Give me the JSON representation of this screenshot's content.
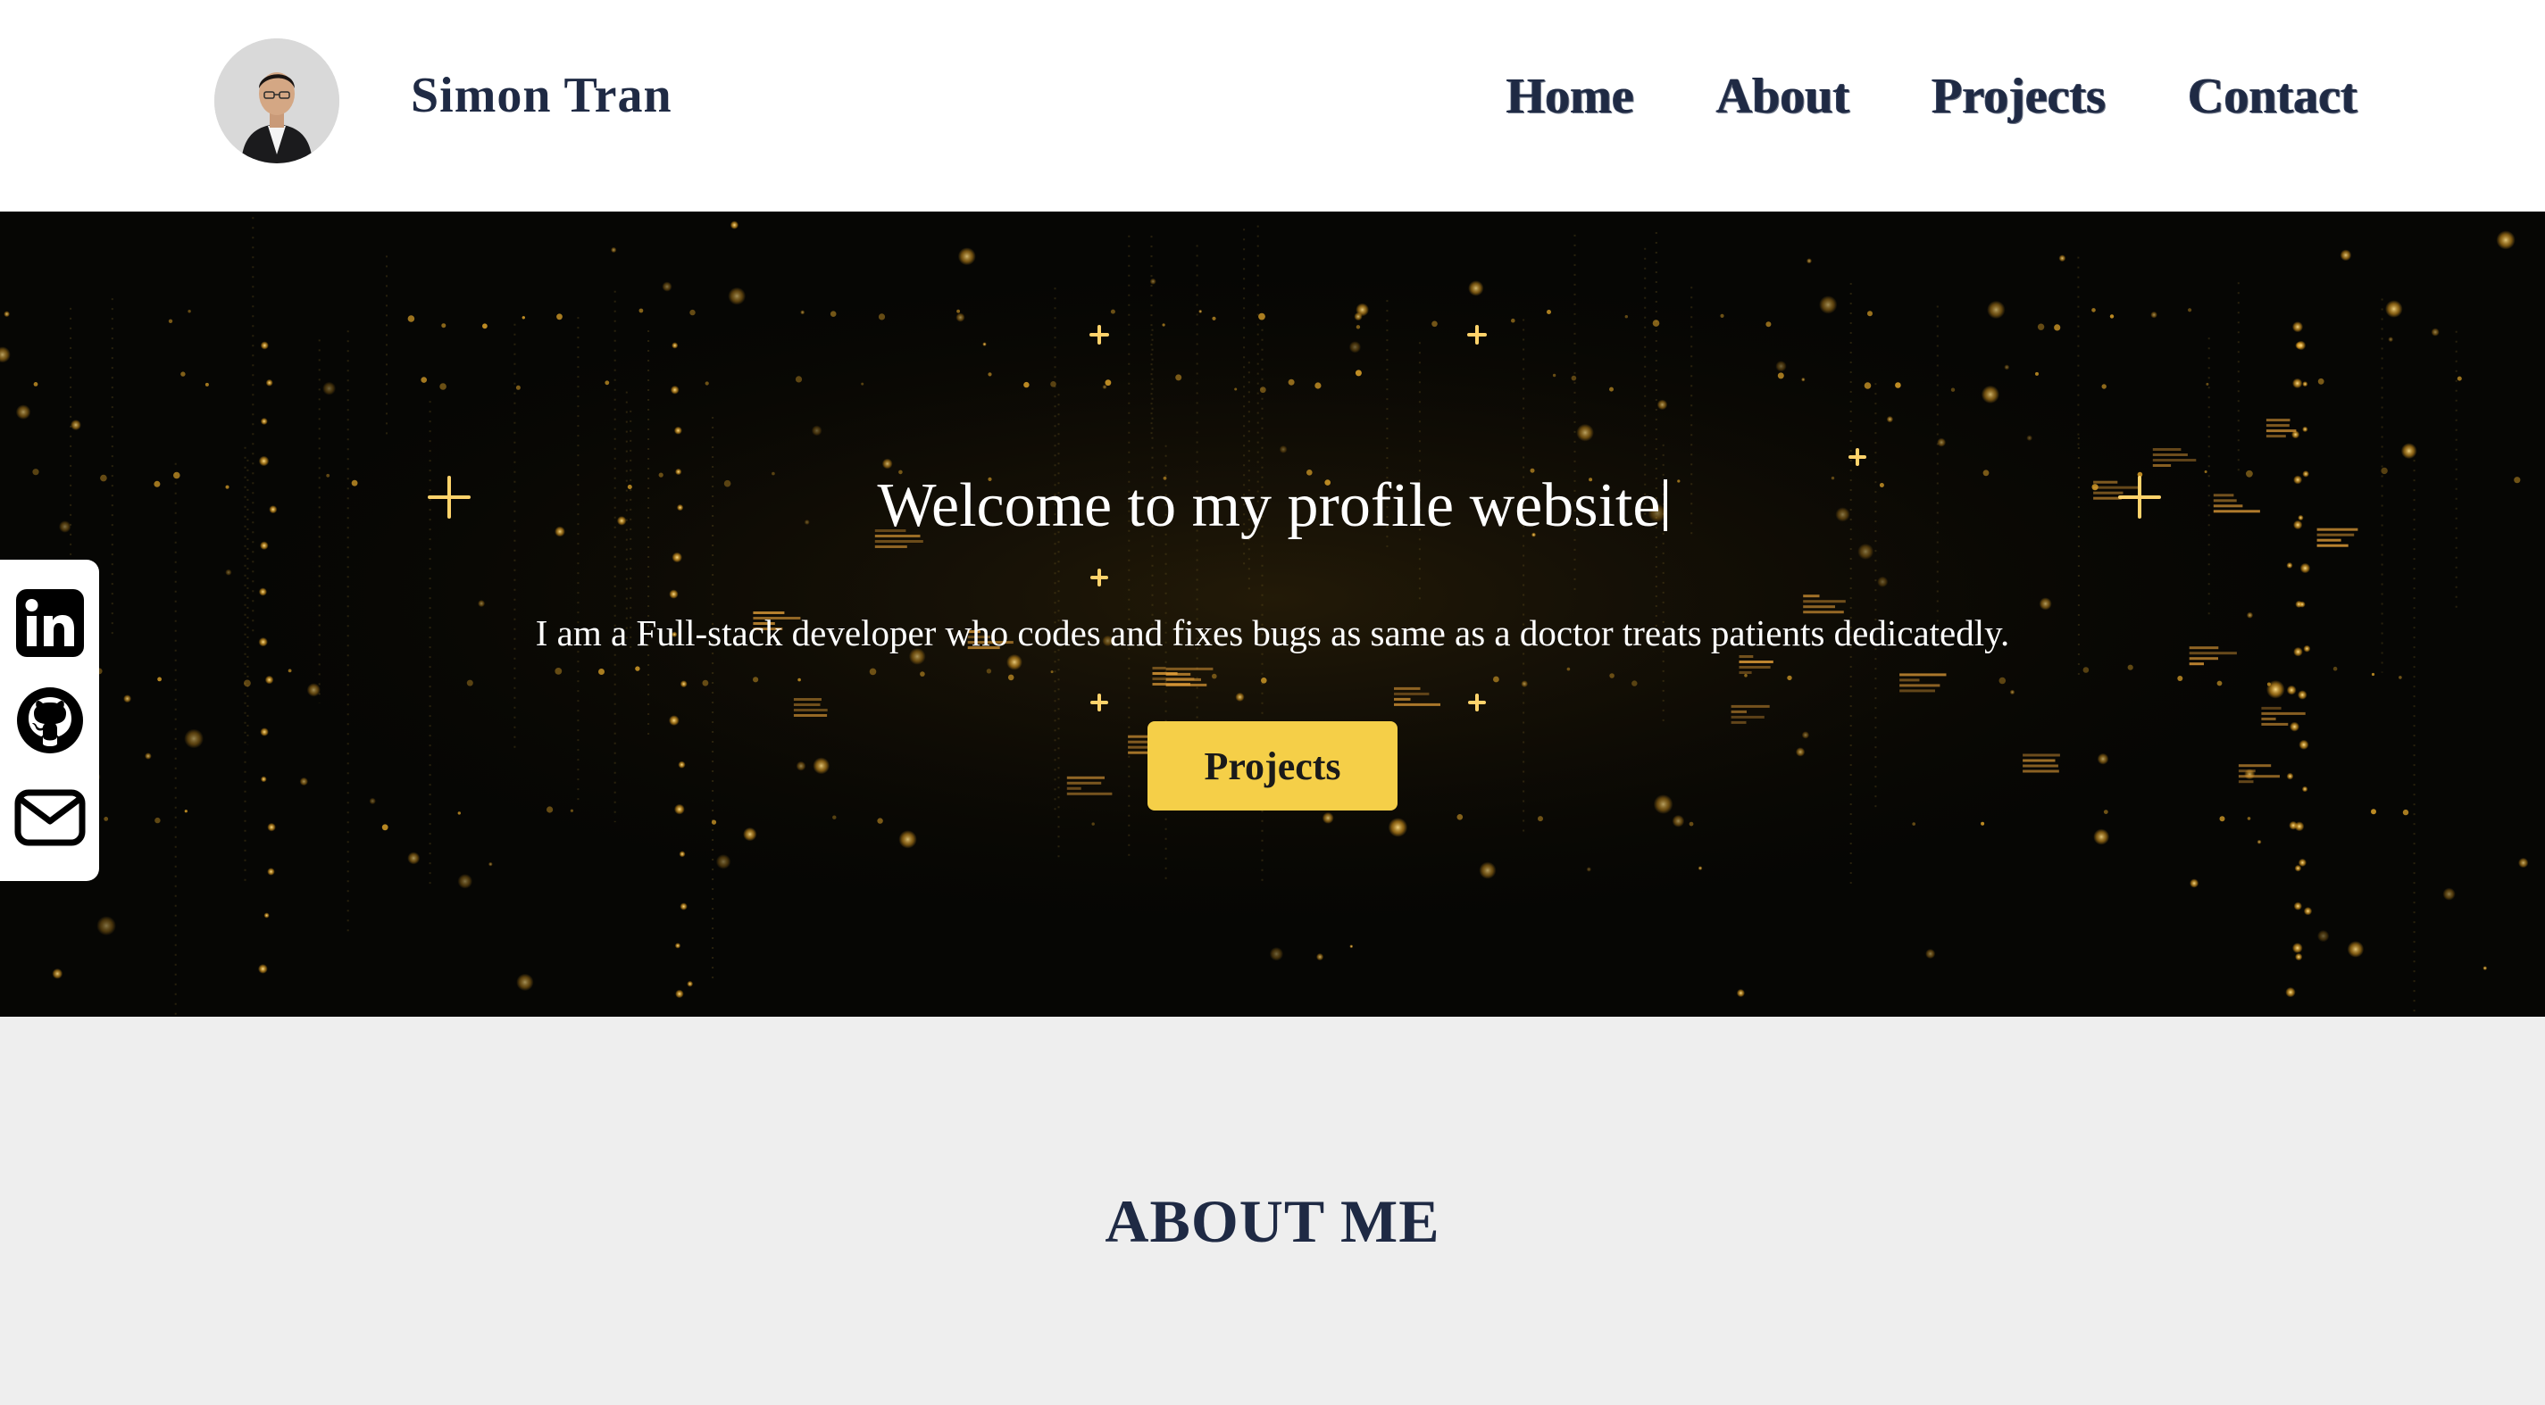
{
  "header": {
    "brand_name": "Simon Tran",
    "nav": {
      "home": "Home",
      "about": "About",
      "projects": "Projects",
      "contact": "Contact"
    }
  },
  "hero": {
    "title": "Welcome to my profile website",
    "subtitle": "I am a Full-stack developer who codes and fixes bugs as same as a doctor treats patients dedicatedly.",
    "button_label": "Projects"
  },
  "social": {
    "items": [
      {
        "icon": "linkedin-icon"
      },
      {
        "icon": "github-icon"
      },
      {
        "icon": "mail-icon"
      }
    ]
  },
  "about": {
    "heading": "ABOUT ME"
  },
  "colors": {
    "navy": "#1f2a44",
    "accent_yellow": "#f5cf48",
    "hero_background": "#060604",
    "section_background": "#eeeeee"
  }
}
